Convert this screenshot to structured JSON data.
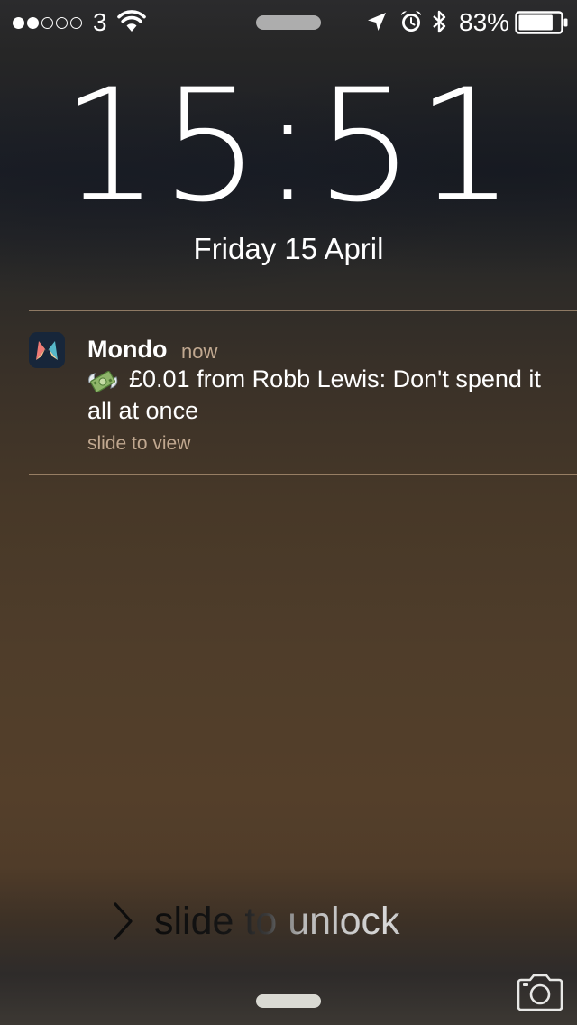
{
  "status_bar": {
    "signal_strength": 2,
    "signal_max": 5,
    "carrier": "3",
    "battery_percent": "83%",
    "battery_level": 0.83,
    "icons": [
      "wifi-icon",
      "location-icon",
      "alarm-icon",
      "bluetooth-icon",
      "battery-icon"
    ]
  },
  "lock_screen": {
    "time": "15:51",
    "date": "Friday 15 April"
  },
  "notification": {
    "app_name": "Mondo",
    "time": "now",
    "emoji_icon": "money-with-wings-icon",
    "message": "£0.01 from Robb Lewis: Don't spend it all at once",
    "action": "slide to view"
  },
  "unlock": {
    "label": "slide to unlock"
  },
  "colors": {
    "notification_meta": "#c8af96",
    "divider": "#dcb996",
    "app_icon_bg": "#17263a"
  }
}
